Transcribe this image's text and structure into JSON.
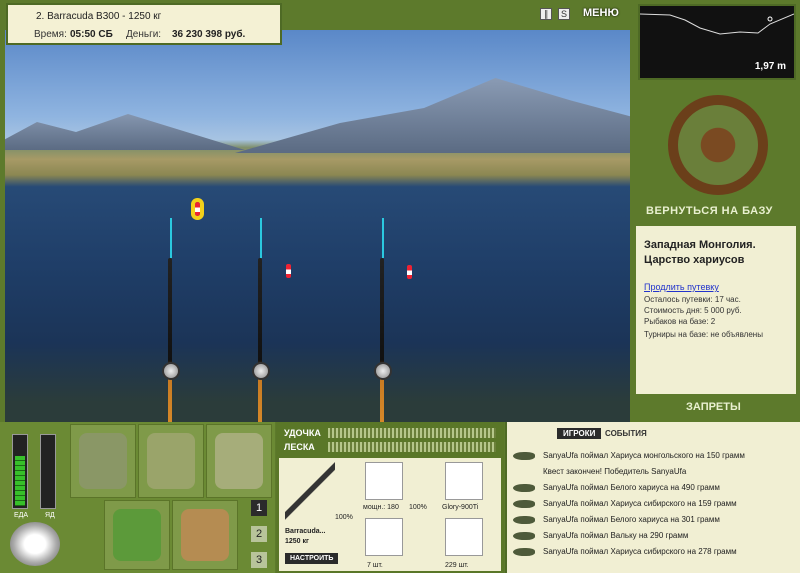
{
  "top": {
    "boat": "2. Barracuda B300 - 1250 кг",
    "time_label": "Время:",
    "time_value": "05:50 СБ",
    "money_label": "Деньги:",
    "money_value": "36 230 398 руб."
  },
  "menu_label": "МЕНЮ",
  "minimap": {
    "depth": "1,97 m"
  },
  "right": {
    "back_label": "ВЕРНУТЬСЯ НА БАЗУ",
    "location_line1": "Западная Монголия.",
    "location_line2": "Царство хариусов",
    "extend_link": "Продлить путевку",
    "remaining": "Осталось путевки: 17 час.",
    "day_cost": "Стоимость дня: 5 000 руб.",
    "anglers": "Рыбаков на базе: 2",
    "tournaments": "Турниры на базе: не объявлены",
    "bans_label": "ЗАПРЕТЫ"
  },
  "left": {
    "food_label": "ЕДА",
    "poison_label": "ЯД",
    "food_level": 0.7,
    "poison_level": 0,
    "pages": [
      "1",
      "2",
      "3"
    ]
  },
  "gear": {
    "rod_label": "УДОЧКА",
    "line_label": "ЛЕСКА",
    "rod_name": "Barracuda...",
    "rod_weight": "1250 кг",
    "rod_pct": "100%",
    "reel_power": "мощн.: 180",
    "reel_pct": "100%",
    "line_name": "Glory-900Ti",
    "hook_count": "7 шт.",
    "bait_count": "229 шт.",
    "setup_label": "НАСТРОИТЬ"
  },
  "chat": {
    "tab_players": "ИГРОКИ",
    "tab_events": "СОБЫТИЯ",
    "messages": [
      "SanyaUfa поймал Хариуса монгольского на 150 грамм",
      "Квест закончен! Победитель SanyaUfa",
      "SanyaUfa поймал Белого хариуса на 490 грамм",
      "SanyaUfa поймал Хариуса сибирского на 159 грамм",
      "SanyaUfa поймал Белого хариуса на 301 грамм",
      "SanyaUfa поймал Вальку на 290 грамм",
      "SanyaUfa поймал Хариуса сибирского на 278 грамм"
    ]
  },
  "colors": {
    "panel": "#5d7a2c",
    "card": "#f1efd3",
    "accent_yellow": "#f2d01a"
  }
}
